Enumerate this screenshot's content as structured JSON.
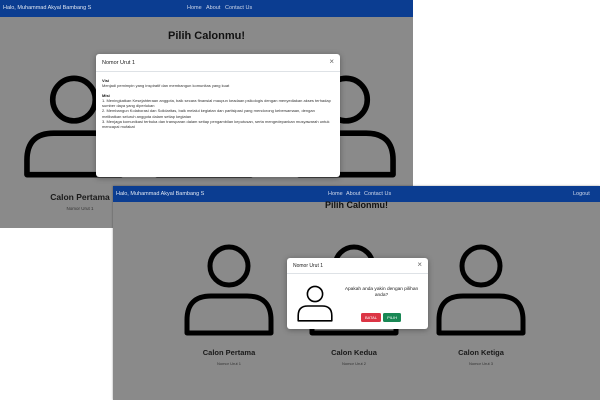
{
  "screen1": {
    "navbar": {
      "brand": "Halo, Muhammad Akyal Bambang S",
      "links": [
        "Home",
        "About",
        "Contact Us"
      ]
    },
    "page_title": "Pilih Calonmu!",
    "candidate": {
      "name": "Calon Pertama",
      "number": "Nomor Urut 1"
    },
    "modal": {
      "title": "Nomor Urut 1",
      "close": "×",
      "visi_title": "Visi",
      "visi_text": "Menjadi pemimpin yang inspiratif dan membangun komunitas yang kuat",
      "misi_title": "Misi",
      "misi_1": "1. Meningkatkan Kesejahteraan anggota, baik secara finansial maupun keadaan psikologis dengan menyediakan akses terhadap sumber daya yang diperlukan",
      "misi_2": "2. Membangun Kolaborasi dan Solidaritas, baik melalui kegiatan dan partisipasi yang mendorong kebersamaan, dengan melibatkan seluruh anggota dalam setiap kegiatan",
      "misi_3": "3. Menjaga komunikasi terbuka dan transparan dalam setiap pengambilan keputusan, serta mengedepankan musyawarah untuk mencapai mufakat"
    }
  },
  "screen2": {
    "navbar": {
      "brand": "Halo, Muhammad Akyal Bambang S",
      "links": [
        "Home",
        "About",
        "Contact Us"
      ],
      "logout": "Logout"
    },
    "page_title": "Pilih Calonmu!",
    "candidates": [
      {
        "name": "Calon Pertama",
        "number": "Nomor Urut 1"
      },
      {
        "name": "Calon Kedua",
        "number": "Nomor Urut 2"
      },
      {
        "name": "Calon Ketiga",
        "number": "Nomor Urut 3"
      }
    ],
    "modal": {
      "title": "Nomor Urut 1",
      "close": "×",
      "question": "Apakah anda yakin dengan pilihan anda?",
      "cancel_label": "BATAL",
      "confirm_label": "PILIH"
    }
  },
  "colors": {
    "navbar": "#0b3d91",
    "backdrop": "#8a8a8a",
    "danger": "#dc3545",
    "success": "#198754"
  },
  "icons": {
    "candidate_avatar": "person-icon",
    "modal_close": "close-icon"
  }
}
